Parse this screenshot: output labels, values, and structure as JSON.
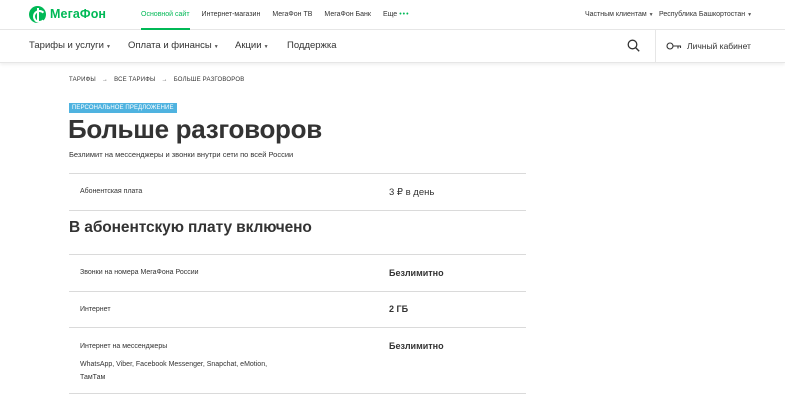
{
  "brand": {
    "name": "МегаФон",
    "color": "#00b956"
  },
  "top_nav": {
    "items": [
      "Основной сайт",
      "Интернет-магазин",
      "МегаФон ТВ",
      "МегаФон Банк",
      "Еще"
    ],
    "more_dots": "•••",
    "segment": "Частным клиентам",
    "region": "Республика Башкортостан"
  },
  "main_nav": {
    "items": [
      "Тарифы и услуги",
      "Оплата и финансы",
      "Акции",
      "Поддержка"
    ],
    "cabinet": "Личный кабинет"
  },
  "breadcrumbs": [
    "ТАРИФЫ",
    "ВСЕ ТАРИФЫ",
    "БОЛЬШЕ РАЗГОВОРОВ"
  ],
  "badge": "ПЕРСОНАЛЬНОЕ ПРЕДЛОЖЕНИЕ",
  "badge_color": "#4fb3e0",
  "title": "Больше разговоров",
  "subtitle": "Безлимит на мессенджеры и звонки внутри сети по всей России",
  "fee": {
    "label": "Абонентская плата",
    "value": "3 ₽ в день"
  },
  "included_heading": "В абонентскую плату включено",
  "included": [
    {
      "label": "Звонки на номера МегаФона России",
      "value": "Безлимитно"
    },
    {
      "label": "Интернет",
      "value": "2 ГБ"
    },
    {
      "label": "Интернет на мессенджеры",
      "value": "Безлимитно",
      "desc": "WhatsApp, Viber, Facebook Messenger, Snapchat, eMotion, ТамТам"
    }
  ]
}
